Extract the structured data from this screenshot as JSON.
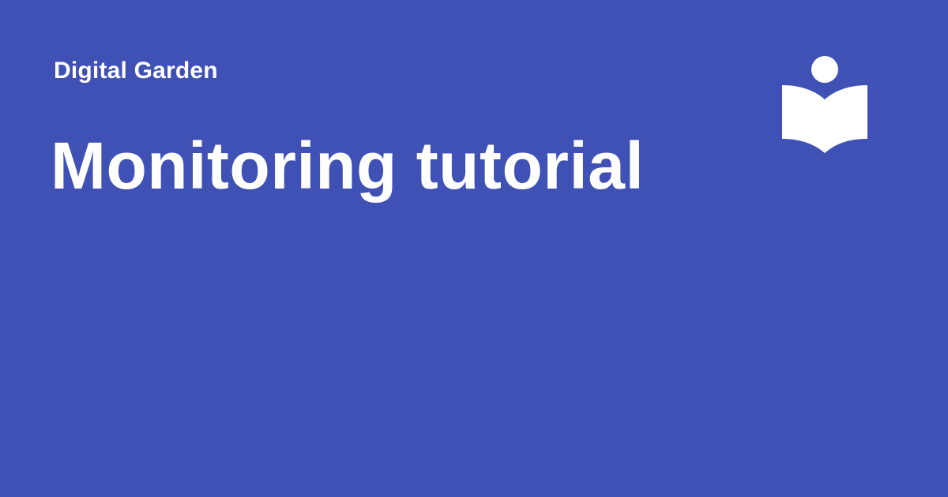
{
  "header": {
    "site_name": "Digital Garden"
  },
  "main": {
    "title": "Monitoring tutorial"
  },
  "logo": {
    "icon": "reader-book-icon"
  },
  "colors": {
    "background": "#3f51b5",
    "text": "#ffffff"
  }
}
